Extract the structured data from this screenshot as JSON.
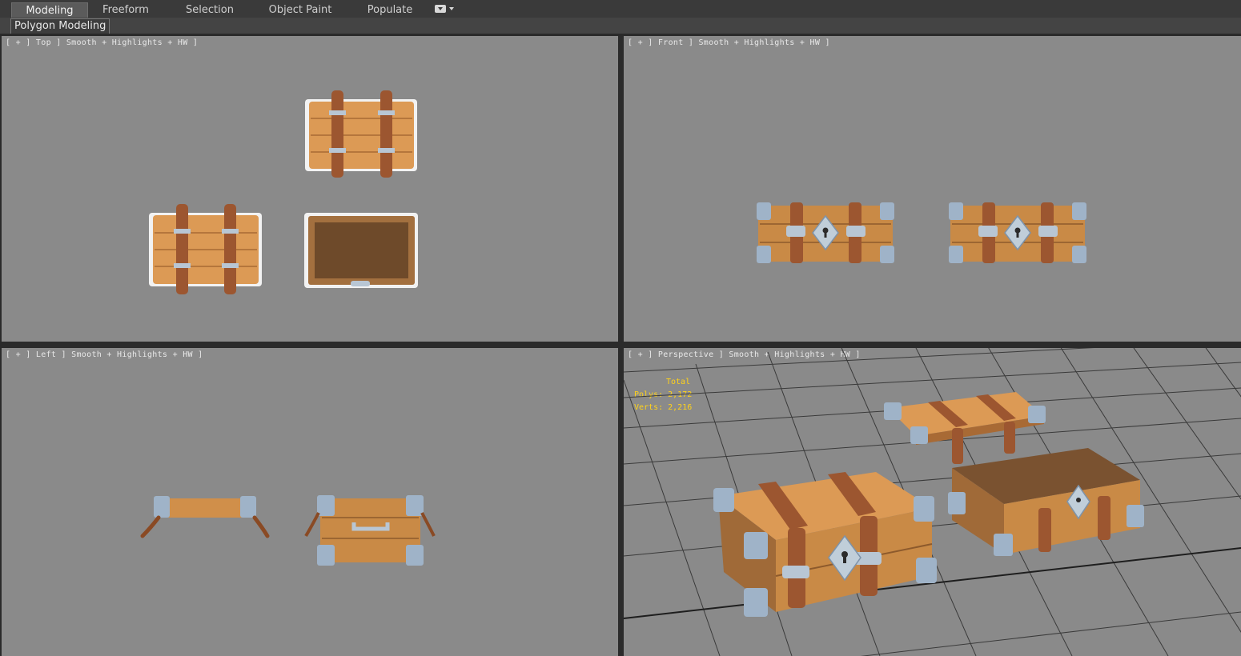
{
  "tabs": [
    "Modeling",
    "Freeform",
    "Selection",
    "Object Paint",
    "Populate"
  ],
  "active_tab": "Modeling",
  "ribbon_panel": "Polygon Modeling",
  "viewports": {
    "top": {
      "label": "[ + ] Top ] Smooth + Highlights + HW ]"
    },
    "front": {
      "label": "[ + ] Front ] Smooth + Highlights + HW ]"
    },
    "left": {
      "label": "[ + ] Left ] Smooth + Highlights + HW ]"
    },
    "perspective": {
      "label": "[ + ] Perspective ] Smooth + Highlights + HW ]",
      "stats": {
        "total": "Total",
        "polys": "Polys: 2,172",
        "verts": "Verts: 2,216"
      }
    }
  },
  "colors": {
    "viewport_bg": "#8a8a8a",
    "wood": "#d9974f",
    "strap": "#9c5630",
    "metal": "#9fb3c8",
    "stats_text": "#ffd21a"
  }
}
